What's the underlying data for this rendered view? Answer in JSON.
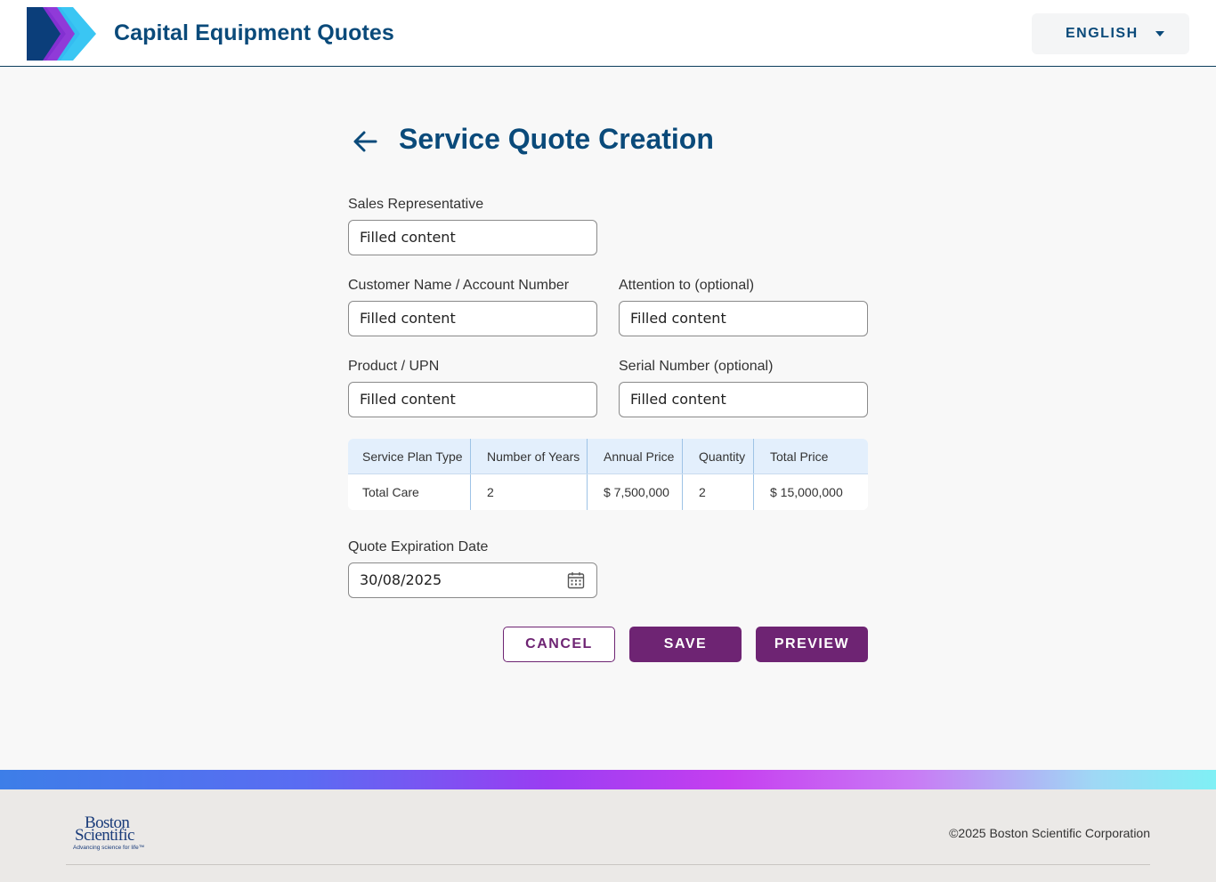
{
  "header": {
    "app_title": "Capital Equipment Quotes",
    "language": "ENGLISH",
    "logo_icon": "chevrons-logo-icon"
  },
  "page": {
    "title": "Service Quote Creation",
    "back_icon": "arrow-left-icon"
  },
  "form": {
    "sales_rep": {
      "label": "Sales Representative",
      "value": "Filled content"
    },
    "customer": {
      "label": "Customer Name / Account Number",
      "value": "Filled content"
    },
    "attention": {
      "label": "Attention to (optional)",
      "value": "Filled content"
    },
    "product": {
      "label": "Product / UPN",
      "value": "Filled content"
    },
    "serial": {
      "label": "Serial Number (optional)",
      "value": "Filled content"
    },
    "expiration": {
      "label": "Quote Expiration Date",
      "value": "30/08/2025",
      "icon": "calendar-icon"
    }
  },
  "table": {
    "headers": [
      "Service Plan Type",
      "Number of Years",
      "Annual Price",
      "Quantity",
      "Total Price"
    ],
    "rows": [
      [
        "Total Care",
        "2",
        "$ 7,500,000",
        "2",
        "$ 15,000,000"
      ]
    ]
  },
  "buttons": {
    "cancel": "CANCEL",
    "save": "SAVE",
    "preview": "PREVIEW"
  },
  "footer": {
    "logo_line1": "Boston",
    "logo_line2": "Scientific",
    "logo_tagline": "Advancing science for life™",
    "copyright": "©2025 Boston Scientific Corporation"
  },
  "colors": {
    "primary_blue": "#0a4a7a",
    "accent_purple": "#6e2473",
    "table_header_bg": "#e3effc"
  }
}
